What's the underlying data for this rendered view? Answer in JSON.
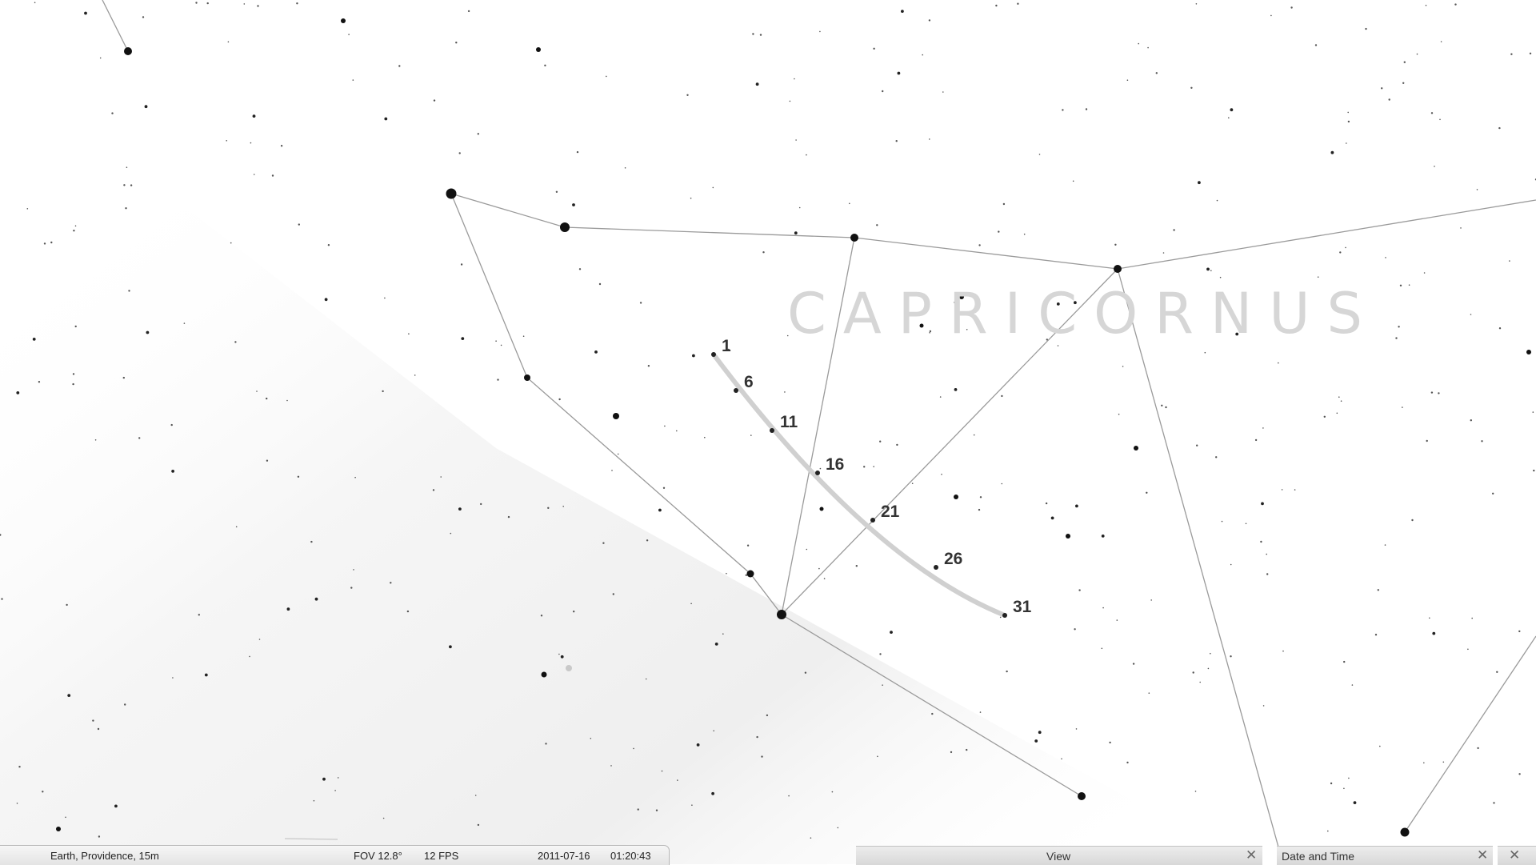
{
  "sky": {
    "constellation_name": "CAPRICORNUS",
    "path_labels": [
      "1",
      "6",
      "11",
      "16",
      "21",
      "26",
      "31"
    ]
  },
  "status_bar": {
    "location": "Earth, Providence, 15m",
    "fov": "FOV 12.8°",
    "fps": "12 FPS",
    "date": "2011-07-16",
    "time": "01:20:43"
  },
  "windows": {
    "view_title": "View",
    "date_title": "Date and Time",
    "close_icon": "close-icon"
  }
}
